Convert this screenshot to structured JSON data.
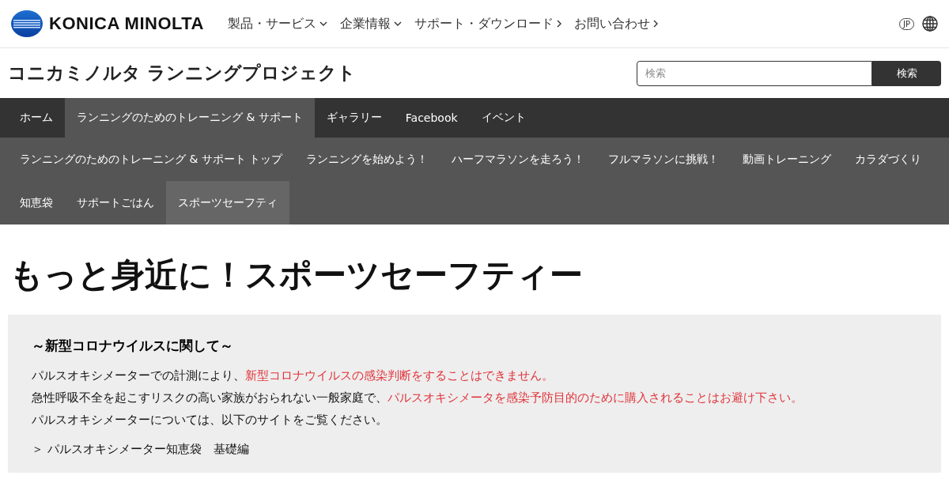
{
  "header": {
    "brand": "KONICA MINOLTA",
    "nav": [
      {
        "label": "製品・サービス",
        "kind": "dropdown"
      },
      {
        "label": "企業情報",
        "kind": "dropdown"
      },
      {
        "label": "サポート・ダウンロード",
        "kind": "link"
      },
      {
        "label": "お問い合わせ",
        "kind": "link"
      }
    ],
    "language": "JP"
  },
  "site": {
    "title": "コニカミノルタ ランニングプロジェクト",
    "search": {
      "placeholder": "検索",
      "button": "検索"
    }
  },
  "main_nav": [
    {
      "label": "ホーム",
      "selected": false
    },
    {
      "label": "ランニングのためのトレーニング & サポート",
      "selected": true
    },
    {
      "label": "ギャラリー",
      "selected": false
    },
    {
      "label": "Facebook",
      "selected": false
    },
    {
      "label": "イベント",
      "selected": false
    }
  ],
  "sub_nav": [
    {
      "label": "ランニングのためのトレーニング & サポート トップ",
      "selected": false
    },
    {
      "label": "ランニングを始めよう！",
      "selected": false
    },
    {
      "label": "ハーフマラソンを走ろう！",
      "selected": false
    },
    {
      "label": "フルマラソンに挑戦！",
      "selected": false
    },
    {
      "label": "動画トレーニング",
      "selected": false
    },
    {
      "label": "カラダづくり",
      "selected": false
    },
    {
      "label": "知恵袋",
      "selected": false
    },
    {
      "label": "サポートごはん",
      "selected": false
    },
    {
      "label": "スポーツセーフティ",
      "selected": true
    }
  ],
  "page_title": "もっと身近に！スポーツセーフティー",
  "notice": {
    "heading": "～新型コロナウイルスに関して～",
    "lines": [
      [
        {
          "text": "パルスオキシメーターでの計測により、",
          "emphasis": false
        },
        {
          "text": "新型コロナウイルスの感染判断をすることはできません。",
          "emphasis": true
        }
      ],
      [
        {
          "text": "急性呼吸不全を起こすリスクの高い家族がおられない一般家庭で、",
          "emphasis": false
        },
        {
          "text": "パルスオキシメータを感染予防目的のために購入されることはお避け下さい。",
          "emphasis": true
        }
      ],
      [
        {
          "text": "パルスオキシメーターについては、以下のサイトをご覧ください。",
          "emphasis": false
        }
      ]
    ],
    "link": {
      "marker": "＞",
      "label": "パルスオキシメーター知恵袋　基礎編"
    }
  }
}
